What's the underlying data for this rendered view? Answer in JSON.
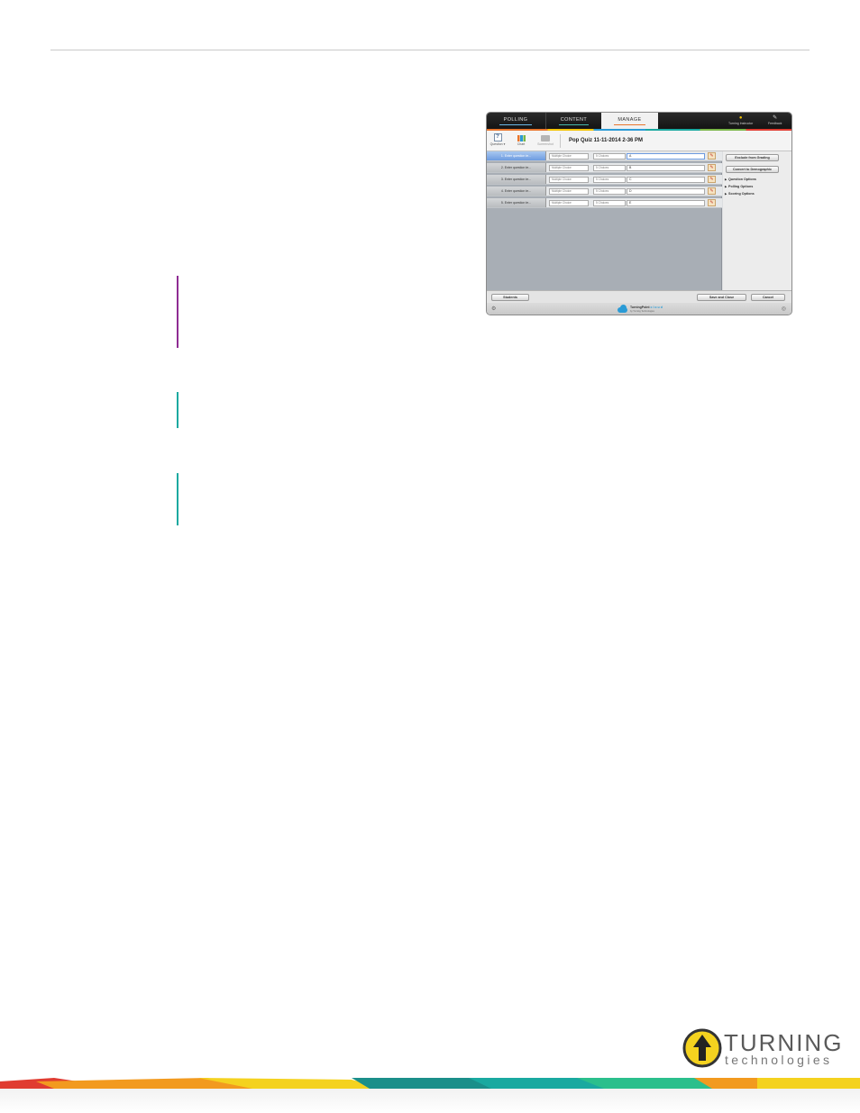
{
  "app": {
    "tabs": [
      {
        "label": "POLLING"
      },
      {
        "label": "CONTENT"
      },
      {
        "label": "MANAGE"
      }
    ],
    "top_right": {
      "instructor": "Turning Instructor",
      "feedback": "Feedback"
    },
    "ribbon": {
      "question": "Question ▾",
      "chart": "Chart",
      "screenshot": "Screenshot"
    },
    "title": "Pop Quiz 11-11-2014 2-36 PM",
    "questions": [
      {
        "label": "1. Enter question te...",
        "type": "Multiple Choice",
        "choices": "5 Choices",
        "answer": "A"
      },
      {
        "label": "2. Enter question te...",
        "type": "Multiple Choice",
        "choices": "5 Choices",
        "answer": "B"
      },
      {
        "label": "3. Enter question te...",
        "type": "Multiple Choice",
        "choices": "5 Choices",
        "answer": "C"
      },
      {
        "label": "4. Enter question te...",
        "type": "Multiple Choice",
        "choices": "5 Choices",
        "answer": "D"
      },
      {
        "label": "5. Enter question te...",
        "type": "Multiple Choice",
        "choices": "5 Choices",
        "answer": "E"
      }
    ],
    "side": {
      "exclude_btn": "Exclude from Grading",
      "convert_btn": "Convert to Demographic",
      "options": [
        "Question Options",
        "Polling Options",
        "Scoring Options"
      ]
    },
    "footer": {
      "students": "Students",
      "save_close": "Save and Close",
      "cancel": "Cancel"
    },
    "status": {
      "brand_name": "TurningPoint",
      "brand_cloud": "cloud",
      "brand_sub": "by Turning Technologies"
    }
  },
  "logo": {
    "line1": "TURNING",
    "line2": "technologies"
  },
  "colors": {
    "purple_callout": "#8e2c93",
    "teal_callout": "#1aa9a0",
    "manage_underline": "#e8762d"
  }
}
